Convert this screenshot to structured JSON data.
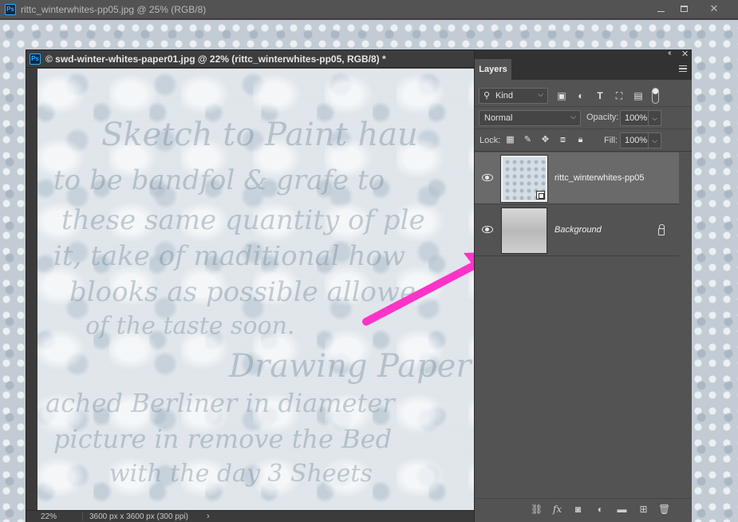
{
  "back_window": {
    "title": "rittc_winterwhites-pp05.jpg @ 25% (RGB/8)",
    "app_badge": "Ps"
  },
  "front_window": {
    "title": "© swd-winter-whites-paper01.jpg @ 22% (rittc_winterwhites-pp05, RGB/8) *",
    "app_badge": "Ps",
    "status": {
      "zoom": "22%",
      "doc_info": "3600 px x 3600 px (300 ppi)"
    },
    "annotation_arrow_color": "#ff33c8"
  },
  "layers_panel": {
    "tab_label": "Layers",
    "filter": {
      "kind_label": "Kind"
    },
    "blend_mode": "Normal",
    "opacity_label": "Opacity:",
    "opacity_value": "100%",
    "lock_label": "Lock:",
    "fill_label": "Fill:",
    "fill_value": "100%",
    "layers": [
      {
        "name": "rittc_winterwhites-pp05",
        "visible": true,
        "selected": true,
        "smart_object": true
      },
      {
        "name": "Background",
        "visible": true,
        "selected": false,
        "locked": true
      }
    ]
  },
  "colors": {
    "panel_bg": "#535353",
    "selected_layer": "#6a6a6a",
    "accent_arrow": "#ff33c8"
  }
}
